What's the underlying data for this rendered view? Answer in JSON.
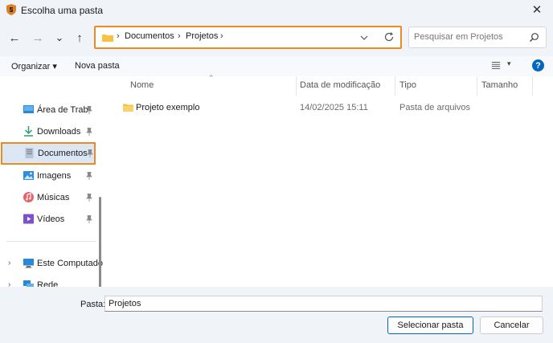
{
  "window": {
    "title": "Escolha uma pasta",
    "close_glyph": "✕"
  },
  "nav": {
    "back_glyph": "←",
    "forward_glyph": "→",
    "recent_glyph": "⌄",
    "up_glyph": "↑"
  },
  "address": {
    "separator": "›",
    "crumbs": [
      "Documentos",
      "Projetos"
    ]
  },
  "search": {
    "placeholder": "Pesquisar em Projetos"
  },
  "toolbar": {
    "organize_label": "Organizar ▾",
    "new_folder_label": "Nova pasta",
    "view_caret": "▾",
    "help_glyph": "?"
  },
  "sidebar": {
    "items": [
      {
        "label": "Área de Trab",
        "icon": "desktop-icon",
        "pinned": true
      },
      {
        "label": "Downloads",
        "icon": "download-icon",
        "pinned": true
      },
      {
        "label": "Documentos",
        "icon": "documents-icon",
        "pinned": true,
        "selected": true
      },
      {
        "label": "Imagens",
        "icon": "pictures-icon",
        "pinned": true
      },
      {
        "label": "Músicas",
        "icon": "music-icon",
        "pinned": true
      },
      {
        "label": "Vídeos",
        "icon": "videos-icon",
        "pinned": true
      }
    ],
    "tree": [
      {
        "label": "Este Computado",
        "icon": "computer-icon",
        "expand_glyph": "›"
      },
      {
        "label": "Rede",
        "icon": "network-icon",
        "expand_glyph": "›"
      }
    ]
  },
  "columns": {
    "name": "Nome",
    "date": "Data de modificação",
    "type": "Tipo",
    "size": "Tamanho",
    "sort_glyph": "⌃"
  },
  "rows": [
    {
      "name": "Projeto exemplo",
      "date": "14/02/2025 15:11",
      "type": "Pasta de arquivos",
      "size": ""
    }
  ],
  "footer": {
    "folder_label": "Pasta:",
    "folder_value": "Projetos",
    "select_label": "Selecionar pasta",
    "cancel_label": "Cancelar"
  },
  "colors": {
    "accent": "#ef8a22",
    "folder": "#f6c344",
    "brand_blue": "#0067c0",
    "selected_bg": "#dbe7f5"
  }
}
